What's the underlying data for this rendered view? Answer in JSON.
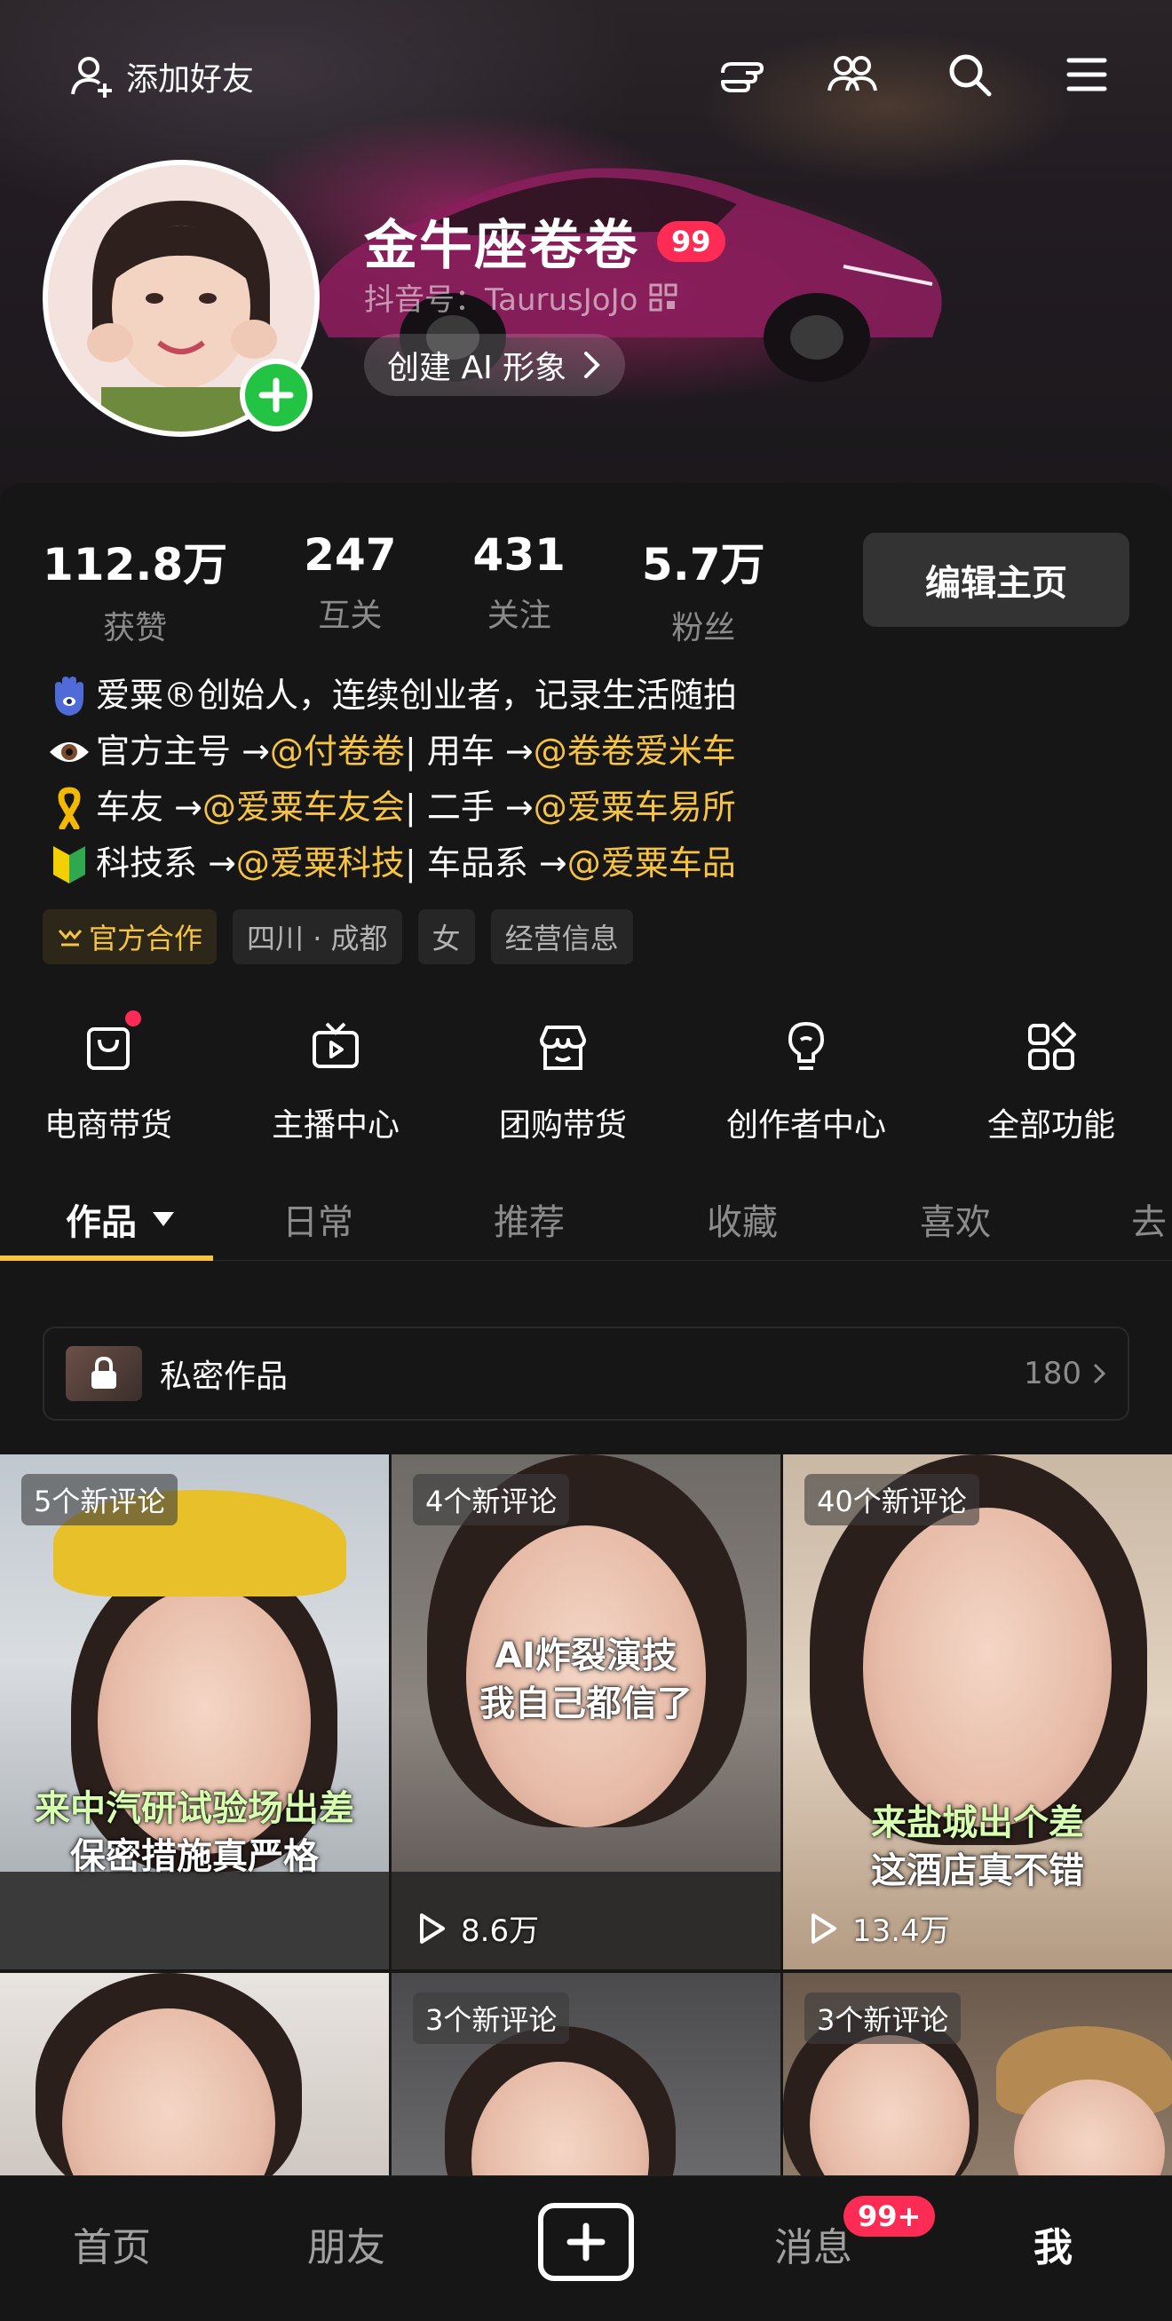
{
  "topbar": {
    "add_friend_label": "添加好友"
  },
  "profile": {
    "name": "金牛座卷卷",
    "level_badge": "99",
    "douyin_id": "抖音号：TaurusJoJo",
    "ai_button": "创建 AI 形象"
  },
  "stats": [
    {
      "value": "112.8万",
      "label": "获赞"
    },
    {
      "value": "247",
      "label": "互关"
    },
    {
      "value": "431",
      "label": "关注"
    },
    {
      "value": "5.7万",
      "label": "粉丝"
    }
  ],
  "edit_button": "编辑主页",
  "bio": {
    "line1": {
      "text": "爱粟®创始人，连续创业者，记录生活随拍"
    },
    "line2": {
      "a": "官方主号 →",
      "m1": "@付卷卷",
      "b": " | 用车 →",
      "m2": "@卷卷爱米车"
    },
    "line3": {
      "a": "车友 →",
      "m1": "@爱粟车友会",
      "b": " | 二手 →",
      "m2": "@爱粟车易所"
    },
    "line4": {
      "a": "科技系 →",
      "m1": "@爱粟科技",
      "b": " | 车品系 →",
      "m2": "@爱粟车品"
    }
  },
  "tags": {
    "official": "官方合作",
    "location": "四川 · 成都",
    "gender": "女",
    "business": "经营信息"
  },
  "tools": [
    {
      "label": "电商带货",
      "icon": "shopping-bag-icon"
    },
    {
      "label": "主播中心",
      "icon": "tv-play-icon"
    },
    {
      "label": "团购带货",
      "icon": "store-icon"
    },
    {
      "label": "创作者中心",
      "icon": "lightbulb-icon"
    },
    {
      "label": "全部功能",
      "icon": "grid-apps-icon"
    }
  ],
  "tabs": [
    "作品",
    "日常",
    "推荐",
    "收藏",
    "喜欢",
    "去"
  ],
  "private_works": {
    "label": "私密作品",
    "count": "180"
  },
  "videos": [
    {
      "comments": "5个新评论",
      "caption1": "来中汽研试验场出差",
      "caption2": "保密措施真严格",
      "plays": ""
    },
    {
      "comments": "4个新评论",
      "caption1": "AI炸裂演技",
      "caption2": "我自己都信了",
      "plays": "8.6万"
    },
    {
      "comments": "40个新评论",
      "caption1": "来盐城出个差",
      "caption2": "这酒店真不错",
      "plays": "13.4万"
    },
    {
      "comments": "",
      "caption1": "",
      "caption2": "",
      "plays": ""
    },
    {
      "comments": "3个新评论",
      "caption1": "",
      "caption2": "",
      "plays": ""
    },
    {
      "comments": "3个新评论",
      "caption1": "",
      "caption2": "",
      "plays": ""
    }
  ],
  "bottom_nav": {
    "home": "首页",
    "friends": "朋友",
    "messages": "消息",
    "messages_badge": "99+",
    "me": "我"
  },
  "colors": {
    "accent_yellow": "#f6c343",
    "badge_red": "#fe2c55",
    "plus_green": "#23c343",
    "background": "#161616"
  }
}
